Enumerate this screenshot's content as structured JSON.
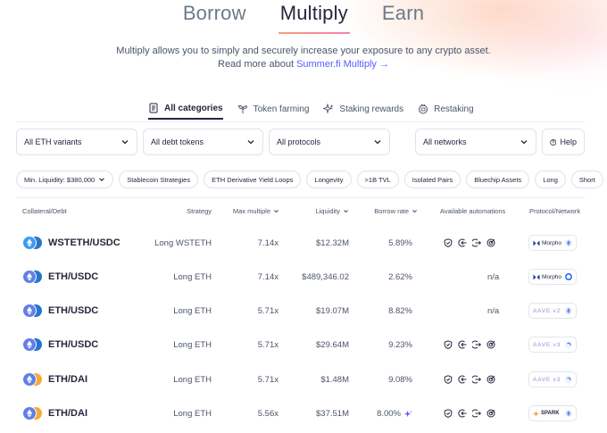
{
  "nav": {
    "tabs": [
      "Borrow",
      "Multiply",
      "Earn"
    ],
    "active": "Multiply"
  },
  "intro": {
    "line1": "Multiply allows you to simply and securely increase your exposure to any crypto asset.",
    "line2_prefix": "Read more about",
    "line2_link": "Summer.fi Multiply →"
  },
  "categories": {
    "all": "All categories",
    "farming": "Token farming",
    "staking": "Staking rewards",
    "restaking": "Restaking"
  },
  "filters": {
    "eth_variants": "All ETH variants",
    "debt_tokens": "All debt tokens",
    "protocols": "All protocols",
    "networks": "All networks",
    "help": "Help"
  },
  "chips": [
    "Min. Liquidity: $380,000",
    "Stablecoin Strategies",
    "ETH Derivative Yield Loops",
    "Longevity",
    ">1B TVL",
    "Isolated Pairs",
    "Bluechip Assets",
    "Long",
    "Short"
  ],
  "table": {
    "headers": {
      "pair": "Collateral/Debt",
      "strategy": "Strategy",
      "multiple": "Max multiple",
      "liquidity": "Liquidity",
      "borrow": "Borrow rate",
      "automations": "Available automations",
      "protocol": "Protocol/Network"
    },
    "rows": [
      {
        "pair": "WSTETH/USDC",
        "strategy": "Long WSTETH",
        "multiple": "7.14x",
        "liquidity": "$12.32M",
        "borrow": "5.89%",
        "automations": [
          "shield-icon",
          "stop-loss-icon",
          "take-profit-icon",
          "target-icon"
        ],
        "na": "",
        "protocol": "Morpho",
        "network": "ethereum",
        "collateral_color": "#3d9bf0",
        "debt_color": "#2775ca"
      },
      {
        "pair": "ETH/USDC",
        "strategy": "Long ETH",
        "multiple": "7.14x",
        "liquidity": "$489,346.02",
        "borrow": "2.62%",
        "automations": [],
        "na": "n/a",
        "protocol": "Morpho",
        "network": "base",
        "collateral_color": "#627eea",
        "debt_color": "#2775ca"
      },
      {
        "pair": "ETH/USDC",
        "strategy": "Long ETH",
        "multiple": "5.71x",
        "liquidity": "$19.07M",
        "borrow": "8.82%",
        "automations": [],
        "na": "n/a",
        "protocol": "AAVE v2",
        "network": "ethereum",
        "collateral_color": "#627eea",
        "debt_color": "#2775ca"
      },
      {
        "pair": "ETH/USDC",
        "strategy": "Long ETH",
        "multiple": "5.71x",
        "liquidity": "$29.64M",
        "borrow": "9.23%",
        "automations": [
          "shield-icon",
          "stop-loss-icon",
          "take-profit-icon",
          "target-icon"
        ],
        "na": "",
        "protocol": "AAVE v3",
        "network": "optimism",
        "collateral_color": "#627eea",
        "debt_color": "#2775ca"
      },
      {
        "pair": "ETH/DAI",
        "strategy": "Long ETH",
        "multiple": "5.71x",
        "liquidity": "$1.48M",
        "borrow": "9.08%",
        "automations": [
          "shield-icon",
          "stop-loss-icon",
          "take-profit-icon",
          "target-icon"
        ],
        "na": "",
        "protocol": "AAVE v3",
        "network": "optimism",
        "collateral_color": "#627eea",
        "debt_color": "#f5ac37"
      },
      {
        "pair": "ETH/DAI",
        "strategy": "Long ETH",
        "multiple": "5.56x",
        "liquidity": "$37.51M",
        "borrow": "8.00%",
        "automations": [
          "shield-icon",
          "stop-loss-icon",
          "take-profit-icon",
          "target-icon"
        ],
        "na": "",
        "protocol": "SPARK",
        "network": "ethereum",
        "collateral_color": "#627eea",
        "debt_color": "#f5ac37"
      }
    ]
  },
  "colors": {
    "accent": "#575cfe",
    "text": "#25273d",
    "muted": "#4a5568",
    "aave": "#9b8ee0"
  }
}
